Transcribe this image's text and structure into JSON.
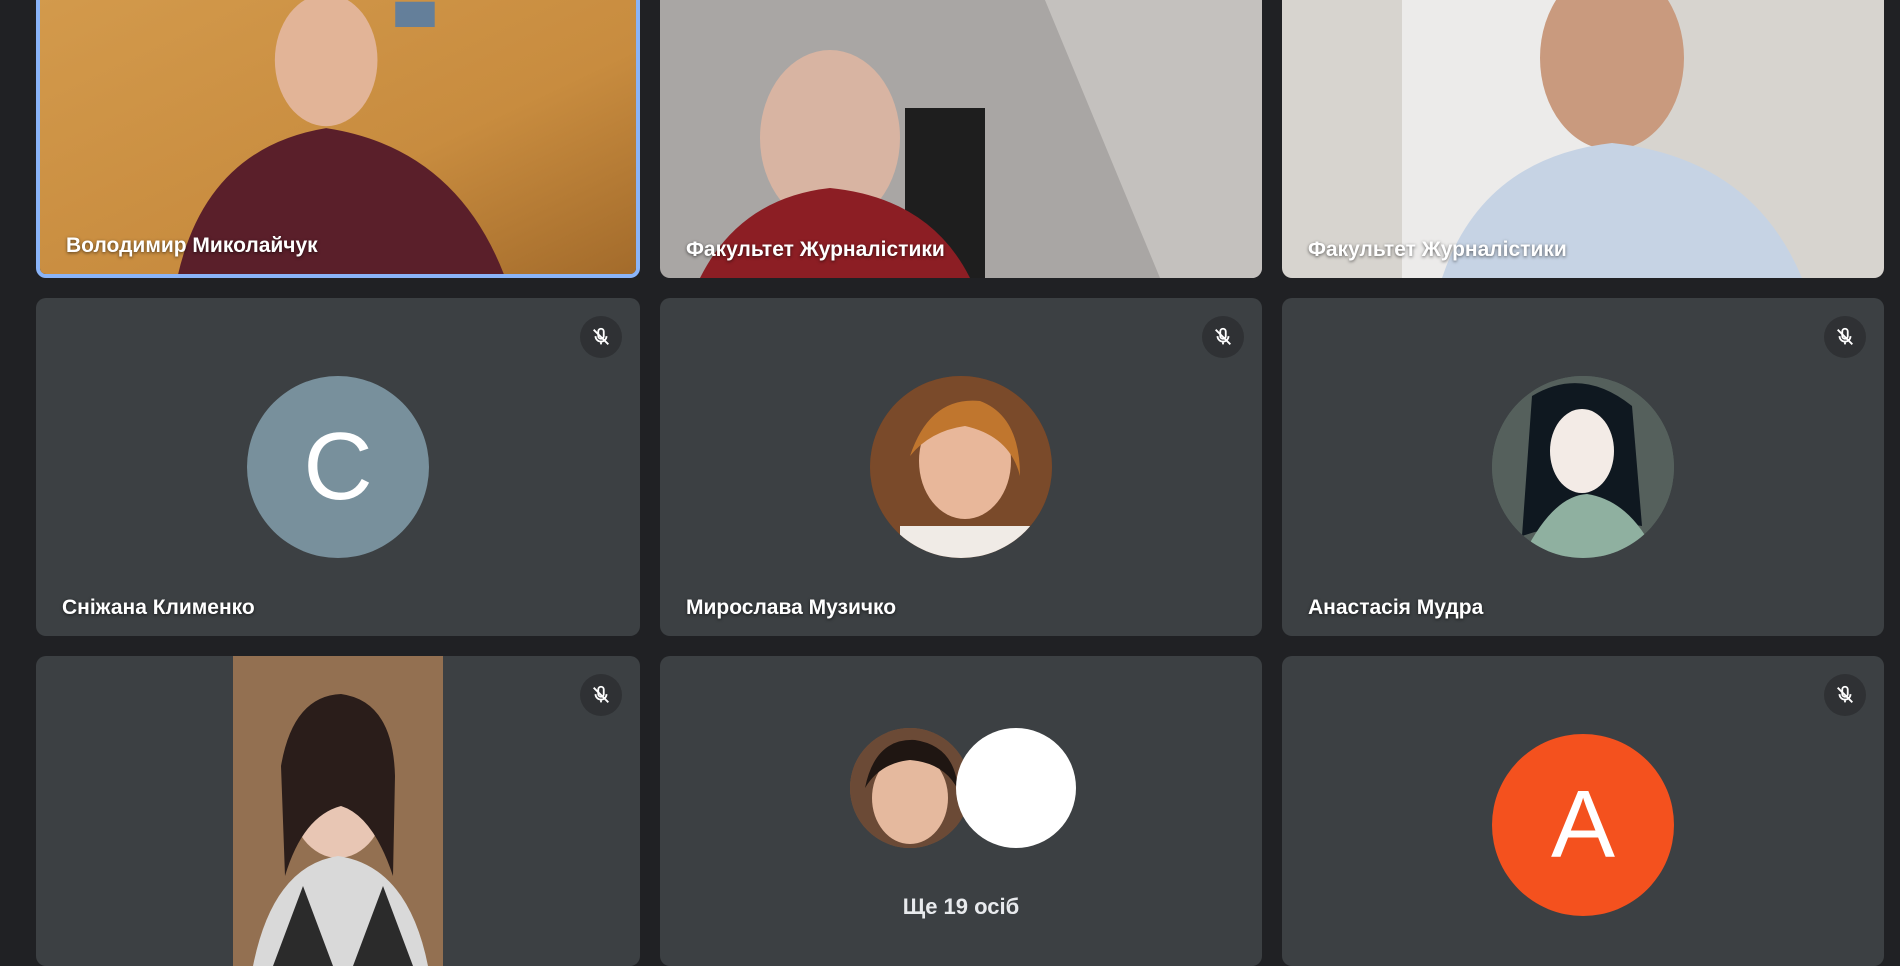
{
  "participants": [
    {
      "name": "Володимир Миколайчук"
    },
    {
      "name": "Факультет Журналістики"
    },
    {
      "name": "Факультет Журналістики"
    },
    {
      "name": "Сніжана Клименко",
      "initial": "С",
      "avatar_color": "#78909c"
    },
    {
      "name": "Мирослава Музичко"
    },
    {
      "name": "Анастасія Мудра"
    },
    {
      "name": ""
    },
    {
      "name": "",
      "initial": "А",
      "avatar_color": "#f4511e"
    }
  ],
  "more": {
    "label": "Ще 19 осіб"
  },
  "icons": {
    "mute": "mic-off-icon"
  },
  "colors": {
    "active_border": "#8ab4f8",
    "tile_bg": "#3c4043",
    "page_bg": "#202124"
  }
}
